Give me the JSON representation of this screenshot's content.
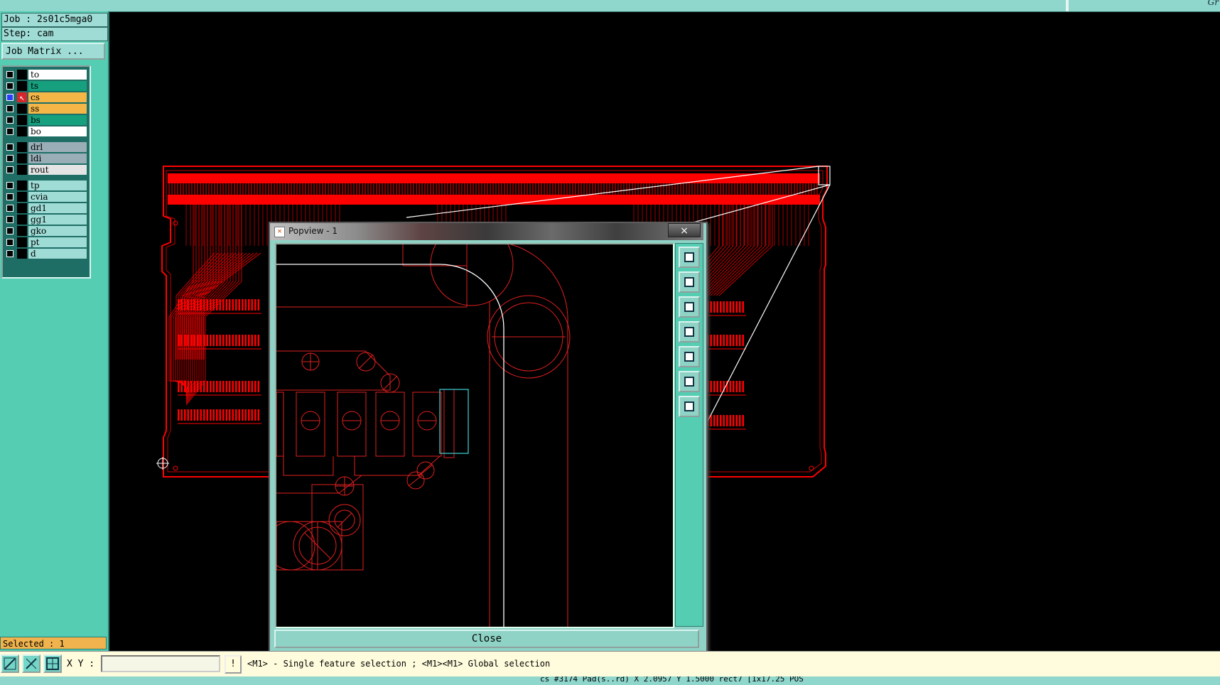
{
  "header": {
    "right_label": "Gr"
  },
  "left_panel": {
    "job": "Job : 2s01c5mga0",
    "step": "Step: cam",
    "job_matrix_button": "Job Matrix ...",
    "layers": [
      {
        "name": "to",
        "color": "#ffffff",
        "checked": false
      },
      {
        "name": "ts",
        "color": "#16a07e",
        "checked": false
      },
      {
        "name": "cs",
        "color": "#f4b646",
        "checked": true,
        "active": true
      },
      {
        "name": "ss",
        "color": "#f4b646",
        "checked": false
      },
      {
        "name": "bs",
        "color": "#16a07e",
        "checked": false
      },
      {
        "name": "bo",
        "color": "#ffffff",
        "checked": false
      },
      {
        "name": "drl",
        "color": "#9aaeb8",
        "checked": false
      },
      {
        "name": "ldi",
        "color": "#9aaeb8",
        "checked": false
      },
      {
        "name": "rout",
        "color": "#e4e4e4",
        "checked": false
      },
      {
        "name": "tp",
        "color": "#9fdcd6",
        "checked": false
      },
      {
        "name": "cvia",
        "color": "#9fdcd6",
        "checked": false
      },
      {
        "name": "gd1",
        "color": "#9fdcd6",
        "checked": false
      },
      {
        "name": "gg1",
        "color": "#9fdcd6",
        "checked": false
      },
      {
        "name": "gko",
        "color": "#9fdcd6",
        "checked": false
      },
      {
        "name": "pt",
        "color": "#9fdcd6",
        "checked": false
      },
      {
        "name": "d",
        "color": "#9fdcd6",
        "checked": false
      }
    ],
    "selected": "Selected : 1"
  },
  "popview": {
    "title": "Popview - 1",
    "close_x": "×",
    "close_button": "Close",
    "tools": [
      "zoom-window-icon",
      "pan-up-icon",
      "pan-down-icon",
      "pan-left-icon",
      "pan-right-icon",
      "zoom-fit-icon",
      "zoom-center-icon"
    ]
  },
  "bottom_bar": {
    "xy_label": "X Y :",
    "xy_value": "",
    "warn_label": "!",
    "hint": "<M1> - Single feature selection ; <M1><M1> Global selection"
  },
  "status_bar": {
    "text": "cs #3174 Pad(s..rd) X 2.0957 Y 1.5000 rect7 [1x17.25 POS"
  },
  "colors": {
    "trace": "#ff0000",
    "panel": "#55cdb3",
    "accent": "#f1b34d"
  }
}
